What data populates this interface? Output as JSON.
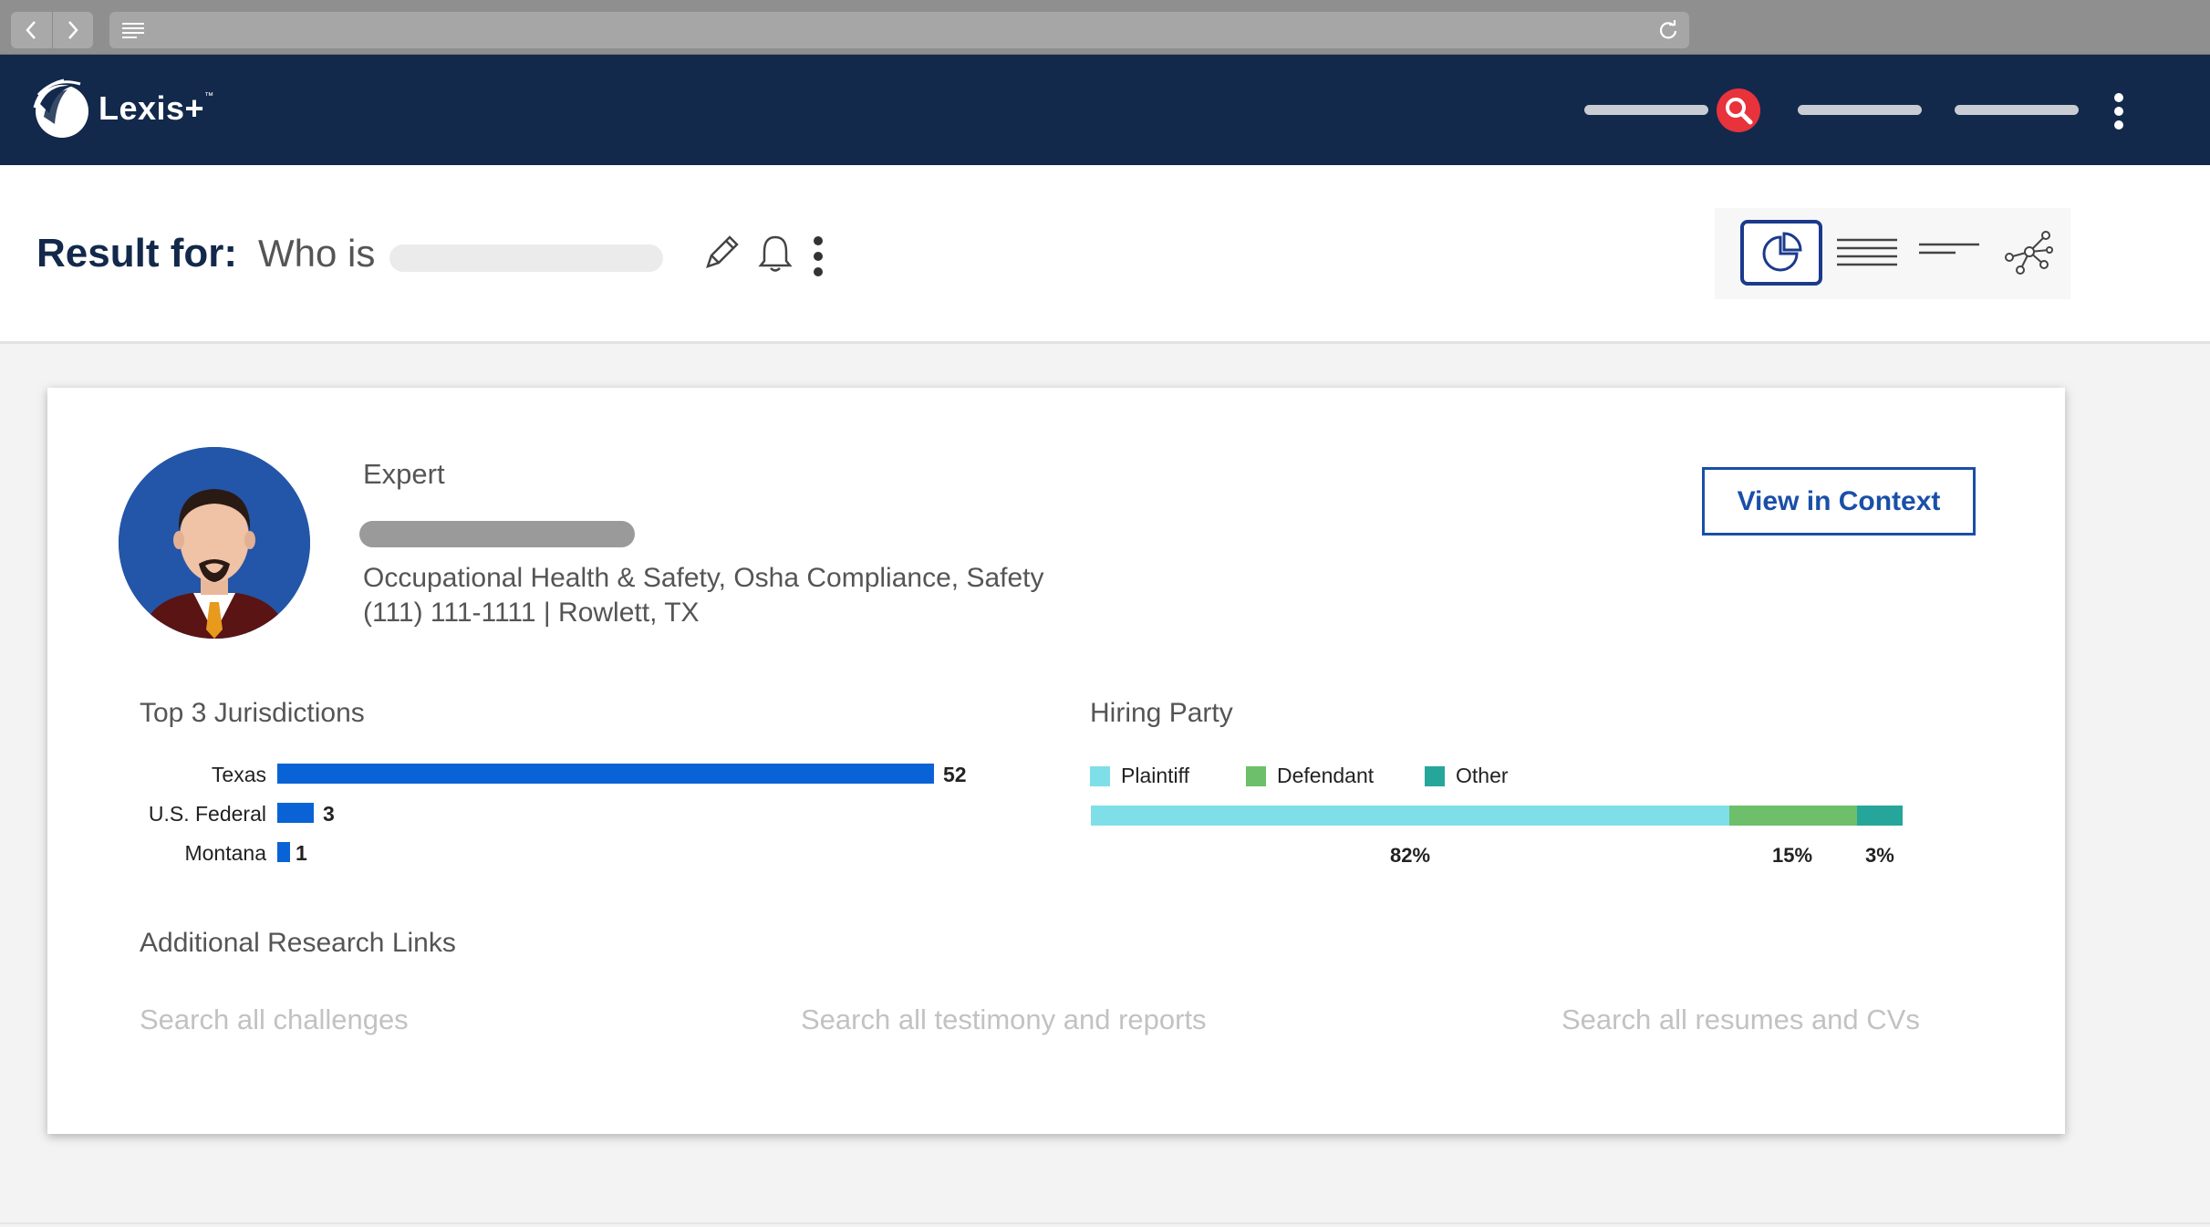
{
  "browser": {
    "back_icon": "chevron-left-icon",
    "forward_icon": "chevron-right-icon",
    "reload_icon": "reload-icon"
  },
  "header": {
    "logo_text": "Lexis+",
    "logo_tm": "™",
    "search_icon": "search-icon",
    "brand_color": "#13294b",
    "search_color": "#e8323c"
  },
  "result": {
    "label": "Result for:",
    "query_prefix": "Who is"
  },
  "profile": {
    "type_label": "Expert",
    "specialties": "Occupational Health & Safety, Osha Compliance, Safety",
    "contact": "(111) 111-1111 | Rowlett, TX",
    "view_context_label": "View in Context"
  },
  "jurisdictions": {
    "title": "Top 3 Jurisdictions",
    "items": [
      {
        "label": "Texas",
        "value": "52"
      },
      {
        "label": "U.S. Federal",
        "value": "3"
      },
      {
        "label": "Montana",
        "value": "1"
      }
    ],
    "bar_color": "#0a63d6"
  },
  "hiring_party": {
    "title": "Hiring Party",
    "segments": [
      {
        "label": "Plaintiff",
        "percent": "82%",
        "color": "#7fdfe8"
      },
      {
        "label": "Defendant",
        "percent": "15%",
        "color": "#6dbf6b"
      },
      {
        "label": "Other",
        "percent": "3%",
        "color": "#26a69a"
      }
    ]
  },
  "research": {
    "title": "Additional Research Links",
    "links": [
      "Search all challenges",
      "Search all testimony and reports",
      "Search all resumes and CVs"
    ]
  }
}
